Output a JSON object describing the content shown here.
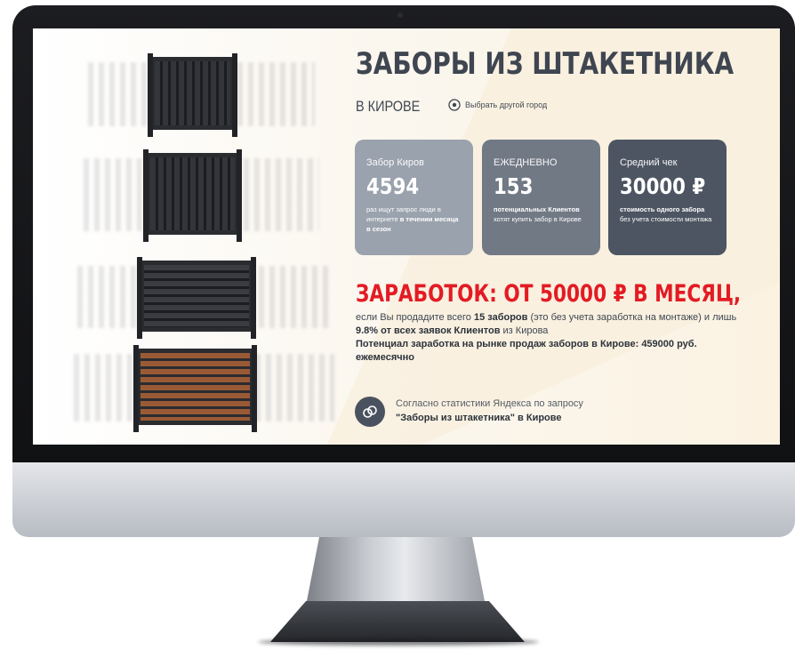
{
  "headline": "ЗАБОРЫ ИЗ ШТАКЕТНИКА",
  "city": "В КИРОВЕ",
  "change_city": "Выбрать другой город",
  "cards": [
    {
      "label": "Забор Киров",
      "value": "4594",
      "desc_plain_1": "раз ищут запрос люди в интернете ",
      "desc_bold": "в течении месяца в сезон",
      "desc_plain_2": ""
    },
    {
      "label": "ЕЖЕДНЕВНО",
      "value": "153",
      "desc_plain_1": "",
      "desc_bold": "потенциальных Клиентов",
      "desc_plain_2": " хотят купить забор в Кирове"
    },
    {
      "label": "Средний чек",
      "value": "30000 ₽",
      "desc_plain_1": "",
      "desc_bold": "стоимость одного забора",
      "desc_plain_2": " без учета стоимости монтажа"
    }
  ],
  "earnings": {
    "title": "ЗАРАБОТОК: ОТ 50000 ₽ В МЕСЯЦ,",
    "t1": "если Вы продадите всего ",
    "b1": "15 заборов",
    "t2": " (это без учета заработка на монтаже) и лишь ",
    "b2": "9.8% от всех заявок Клиентов",
    "t3": " из Кирова",
    "b3": "Потенциал заработка на рынке продаж заборов в Кирове: 459000 руб. ежемесячно"
  },
  "stat": {
    "line1": "Согласно статистики Яндекса по запросу",
    "line2": "\"Заборы из штакетника\" в Кирове"
  },
  "icons": {
    "location": "map-pin-icon",
    "stat": "chain-link-icon"
  },
  "colors": {
    "accent_red": "#e31b23",
    "card_1": "#9aa2ad",
    "card_2": "#717985",
    "card_3": "#4d5562",
    "text_dark": "#3f4651"
  }
}
